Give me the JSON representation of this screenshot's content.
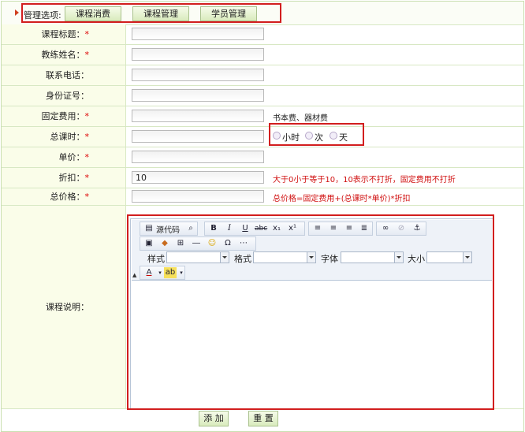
{
  "header": {
    "label": "管理选项:",
    "buttons": [
      "课程消费",
      "课程管理",
      "学员管理"
    ]
  },
  "form": {
    "title_label": "课程标题：",
    "coach_label": "教练姓名：",
    "phone_label": "联系电话：",
    "id_label": "身份证号：",
    "fixed_label": "固定费用：",
    "fixed_hint": "书本费、器材费",
    "hours_label": "总课时：",
    "unit_options": [
      "小时",
      "次",
      "天"
    ],
    "price_label": "单价：",
    "discount_label": "折扣：",
    "discount_value": "10",
    "discount_hint": "大于0小于等于10，10表示不打折，固定费用不打折",
    "total_label": "总价格：",
    "total_hint": "总价格=固定费用+(总课时*单价)*折扣",
    "desc_label": "课程说明：",
    "required_mark": "*"
  },
  "editor": {
    "source_label": "源代码",
    "style_label": "样式",
    "format_label": "格式",
    "font_label": "字体",
    "size_label": "大小"
  },
  "footer": {
    "add_label": "添 加",
    "reset_label": "重 置"
  },
  "colors": {
    "highlight": "#d21e1e",
    "required": "#dd0000",
    "label_bg": "#fafde9"
  }
}
